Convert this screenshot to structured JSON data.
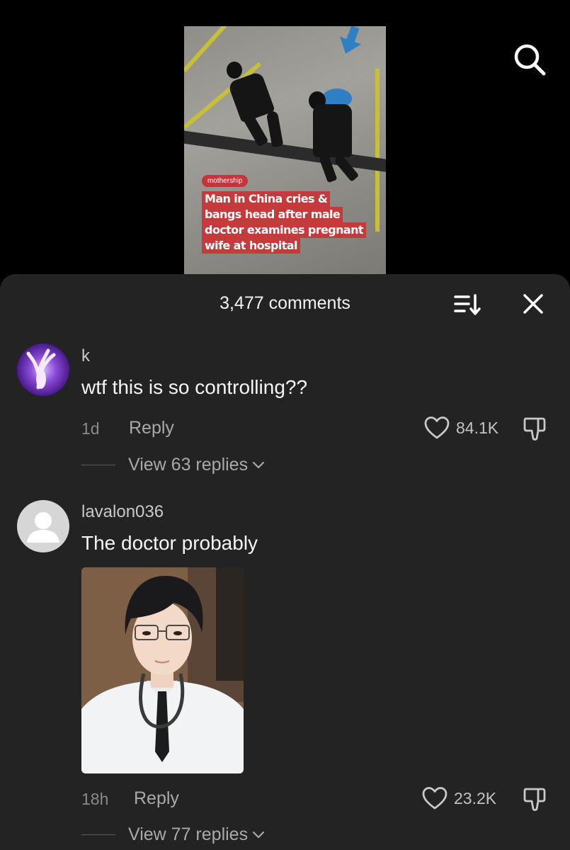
{
  "video": {
    "brand_tag": "mothership",
    "headline_lines": [
      "Man in China cries &",
      "bangs head after male",
      "doctor examines pregnant",
      "wife at hospital"
    ]
  },
  "header": {
    "comments_count": "3,477 comments"
  },
  "comments": [
    {
      "username": "k",
      "text": "wtf this is so controlling??",
      "time": "1d",
      "reply_label": "Reply",
      "likes": "84.1K",
      "view_replies": "View 63 replies"
    },
    {
      "username": "lavalon036",
      "text": "The doctor probably",
      "time": "18h",
      "reply_label": "Reply",
      "likes": "23.2K",
      "view_replies": "View 77 replies"
    }
  ],
  "icons": {
    "search": "search-icon",
    "sort": "sort-icon",
    "close": "close-icon",
    "like": "heart-icon",
    "dislike": "thumbs-down-icon",
    "chevron": "chevron-down-icon"
  },
  "colors": {
    "sheet_bg": "#232323",
    "headline_bg": "#c53a3b",
    "brand_tag_bg": "#c8323a"
  }
}
